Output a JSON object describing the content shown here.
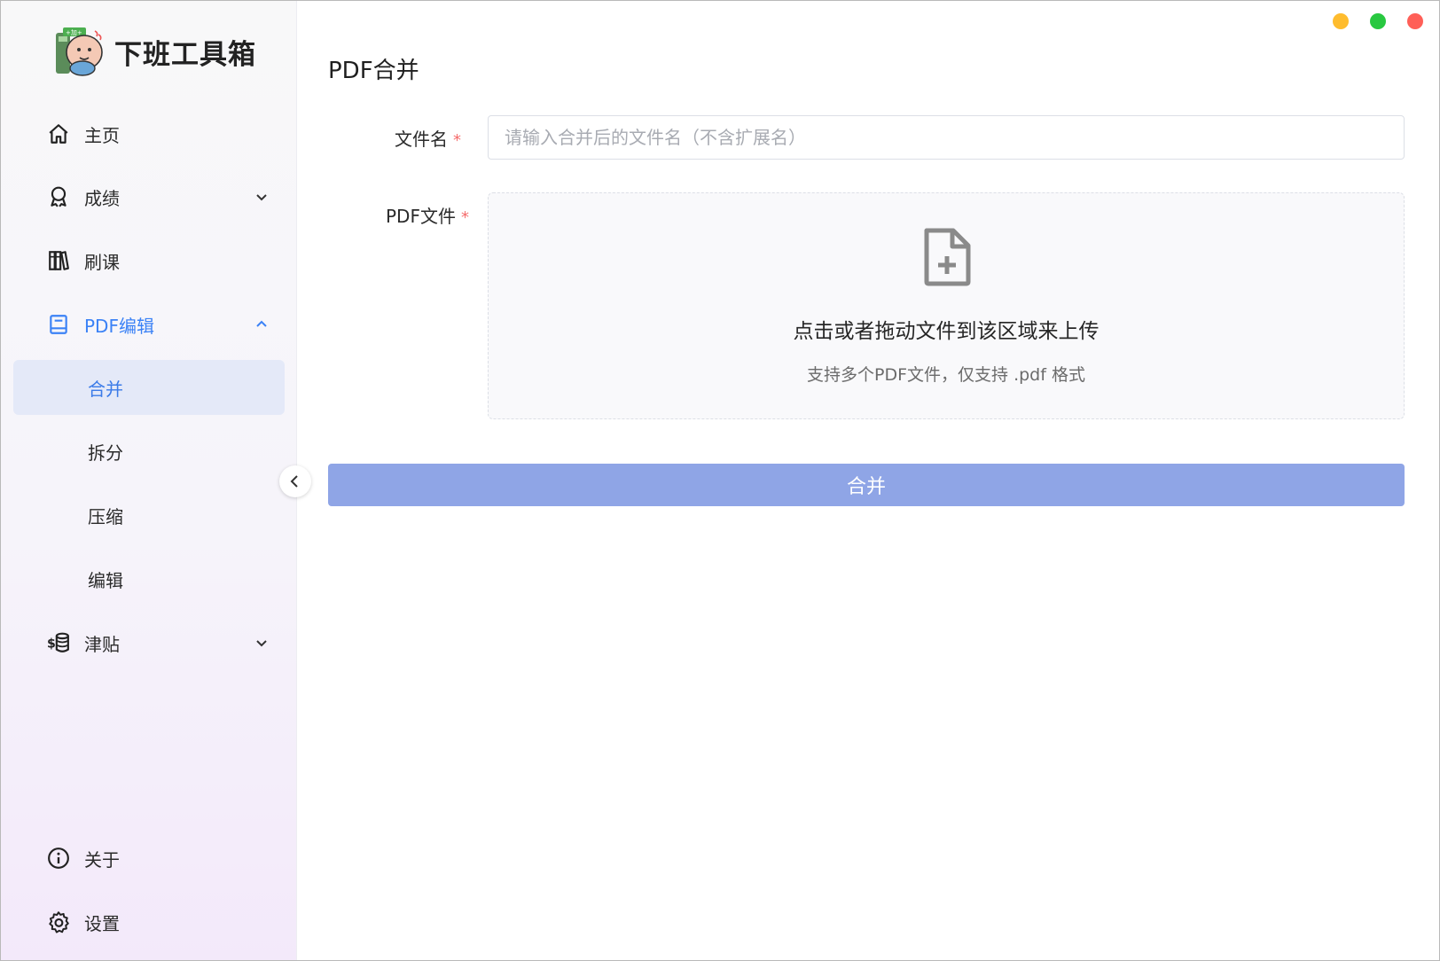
{
  "app": {
    "title": "下班工具箱",
    "logo_icon": "cartoon-avatar-logo"
  },
  "window_controls": [
    {
      "name": "minimize",
      "color": "#febc2e"
    },
    {
      "name": "maximize",
      "color": "#28c840"
    },
    {
      "name": "close",
      "color": "#ff5f57"
    }
  ],
  "sidebar": {
    "items": [
      {
        "label": "主页",
        "icon": "home-icon"
      },
      {
        "label": "成绩",
        "icon": "award-icon",
        "chevron": "down"
      },
      {
        "label": "刷课",
        "icon": "books-icon"
      },
      {
        "label": "PDF编辑",
        "icon": "book-icon",
        "chevron": "up",
        "expanded": true
      },
      {
        "label": "津贴",
        "icon": "coins-icon",
        "chevron": "down"
      }
    ],
    "pdf_sub_items": [
      {
        "label": "合并",
        "selected": true
      },
      {
        "label": "拆分"
      },
      {
        "label": "压缩"
      },
      {
        "label": "编辑"
      }
    ],
    "bottom_items": [
      {
        "label": "关于",
        "icon": "info-icon"
      },
      {
        "label": "设置",
        "icon": "gear-icon"
      }
    ],
    "accent_color": "#3b82f6",
    "selected_bg": "#e4e9f8"
  },
  "main": {
    "title": "PDF合并",
    "form": {
      "filename_label": "文件名",
      "filename_placeholder": "请输入合并后的文件名（不含扩展名）",
      "filename_value": "",
      "pdf_label": "PDF文件",
      "required_mark": "*",
      "upload": {
        "icon": "file-add-icon",
        "main_text": "点击或者拖动文件到该区域来上传",
        "hint_text": "支持多个PDF文件，仅支持 .pdf 格式"
      },
      "submit_label": "合并",
      "submit_color": "#8fa5e6"
    }
  }
}
